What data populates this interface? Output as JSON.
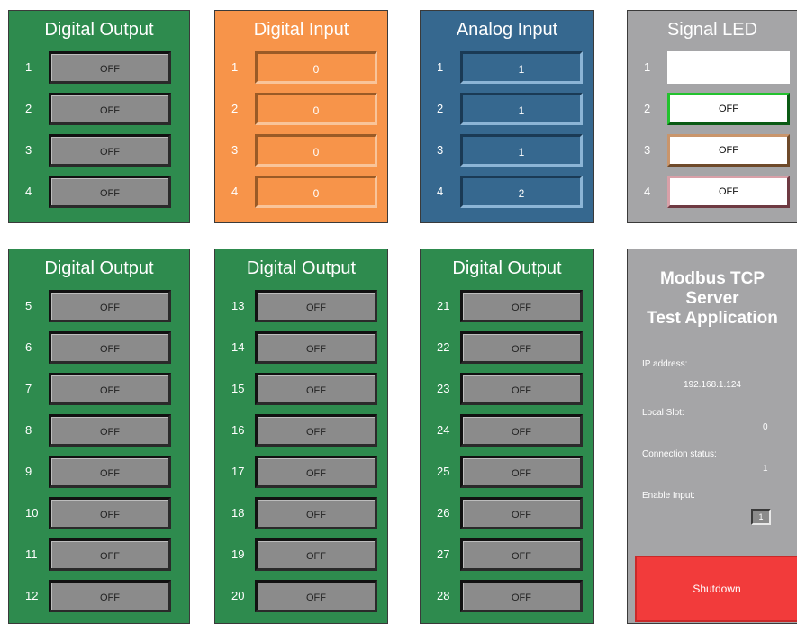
{
  "do_top": {
    "title": "Digital Output",
    "rows": [
      {
        "n": "1",
        "v": "OFF"
      },
      {
        "n": "2",
        "v": "OFF"
      },
      {
        "n": "3",
        "v": "OFF"
      },
      {
        "n": "4",
        "v": "OFF"
      }
    ]
  },
  "di": {
    "title": "Digital Input",
    "rows": [
      {
        "n": "1",
        "v": "0"
      },
      {
        "n": "2",
        "v": "0"
      },
      {
        "n": "3",
        "v": "0"
      },
      {
        "n": "4",
        "v": "0"
      }
    ]
  },
  "ai": {
    "title": "Analog Input",
    "rows": [
      {
        "n": "1",
        "v": "1"
      },
      {
        "n": "2",
        "v": "1"
      },
      {
        "n": "3",
        "v": "1"
      },
      {
        "n": "4",
        "v": "2"
      }
    ]
  },
  "led": {
    "title": "Signal LED",
    "rows": [
      {
        "n": "1",
        "v": ""
      },
      {
        "n": "2",
        "v": "OFF"
      },
      {
        "n": "3",
        "v": "OFF"
      },
      {
        "n": "4",
        "v": "OFF"
      }
    ]
  },
  "do_a": {
    "title": "Digital Output",
    "rows": [
      {
        "n": "5",
        "v": "OFF"
      },
      {
        "n": "6",
        "v": "OFF"
      },
      {
        "n": "7",
        "v": "OFF"
      },
      {
        "n": "8",
        "v": "OFF"
      },
      {
        "n": "9",
        "v": "OFF"
      },
      {
        "n": "10",
        "v": "OFF"
      },
      {
        "n": "11",
        "v": "OFF"
      },
      {
        "n": "12",
        "v": "OFF"
      }
    ]
  },
  "do_b": {
    "title": "Digital Output",
    "rows": [
      {
        "n": "13",
        "v": "OFF"
      },
      {
        "n": "14",
        "v": "OFF"
      },
      {
        "n": "15",
        "v": "OFF"
      },
      {
        "n": "16",
        "v": "OFF"
      },
      {
        "n": "17",
        "v": "OFF"
      },
      {
        "n": "18",
        "v": "OFF"
      },
      {
        "n": "19",
        "v": "OFF"
      },
      {
        "n": "20",
        "v": "OFF"
      }
    ]
  },
  "do_c": {
    "title": "Digital Output",
    "rows": [
      {
        "n": "21",
        "v": "OFF"
      },
      {
        "n": "22",
        "v": "OFF"
      },
      {
        "n": "23",
        "v": "OFF"
      },
      {
        "n": "24",
        "v": "OFF"
      },
      {
        "n": "25",
        "v": "OFF"
      },
      {
        "n": "26",
        "v": "OFF"
      },
      {
        "n": "27",
        "v": "OFF"
      },
      {
        "n": "28",
        "v": "OFF"
      }
    ]
  },
  "info": {
    "title_line1": "Modbus TCP",
    "title_line2": "Server",
    "title_line3": "Test Application",
    "ip_label": "IP address:",
    "ip_value": "192.168.1.124",
    "slot_label": "Local Slot:",
    "slot_value": "0",
    "conn_label": "Connection status:",
    "conn_value": "1",
    "enable_label": "Enable Input:",
    "enable_value": "1",
    "shutdown_label": "Shutdown"
  },
  "colors": {
    "green": "#2e8b4e",
    "orange": "#f7944a",
    "blue": "#36688f",
    "gray": "#a5a5a7",
    "shutdown": "#f23b3b"
  }
}
